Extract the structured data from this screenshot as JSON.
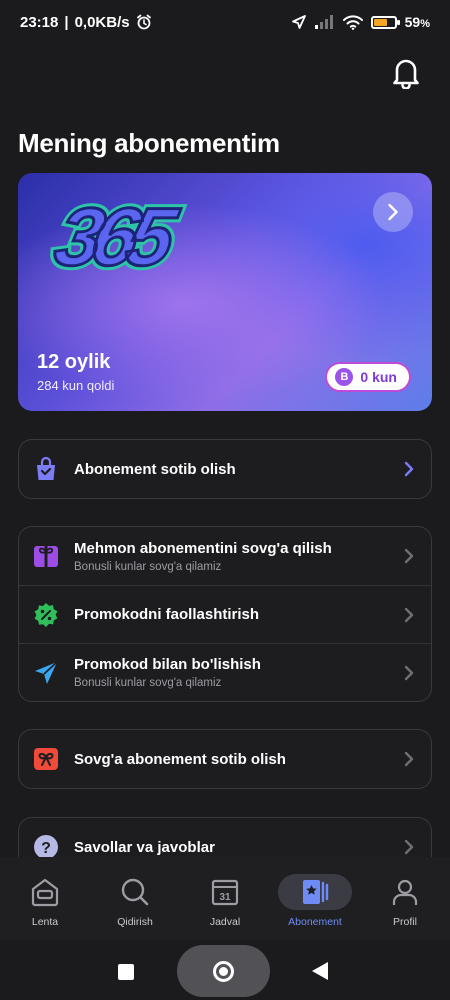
{
  "status_bar": {
    "time": "23:18",
    "speed": "0,0KB/s",
    "battery": "59",
    "battery_level": 0.59
  },
  "page": {
    "title": "Mening abonementim"
  },
  "subscription_card": {
    "logo_text": "365",
    "months": "12 oylik",
    "days_left": "284 kun qoldi",
    "bonus_badge": "B",
    "bonus_days": "0 kun"
  },
  "groups": {
    "buy": {
      "title": "Abonement sotib olish",
      "icon": "shopping-bag-icon",
      "color": "#7c7cf5"
    },
    "gift_guest": {
      "title": "Mehmon abonementini sovg'a qilish",
      "sub": "Bonusli kunlar sovg'a qilamiz",
      "icon": "gift-icon",
      "color": "#9b4de6"
    },
    "promo_activate": {
      "title": "Promokodni faollashtirish",
      "icon": "percent-badge-icon",
      "color": "#2fbf5a"
    },
    "promo_share": {
      "title": "Promokod bilan bo'lishish",
      "sub": "Bonusli kunlar sovg'a qilamiz",
      "icon": "send-icon",
      "color": "#3aa8f0"
    },
    "gift_buy": {
      "title": "Sovg'a abonement sotib olish",
      "icon": "ribbon-icon",
      "color": "#f04a3a"
    },
    "faq": {
      "title": "Savollar va javoblar",
      "icon": "question-icon",
      "color": "#b6b8e6"
    }
  },
  "bottom_nav": [
    {
      "label": "Lenta",
      "icon": "feed-icon"
    },
    {
      "label": "Qidirish",
      "icon": "search-icon"
    },
    {
      "label": "Jadval",
      "icon": "calendar-icon",
      "day": "31"
    },
    {
      "label": "Abonement",
      "icon": "subscription-icon",
      "active": true
    },
    {
      "label": "Profil",
      "icon": "profile-icon"
    }
  ]
}
